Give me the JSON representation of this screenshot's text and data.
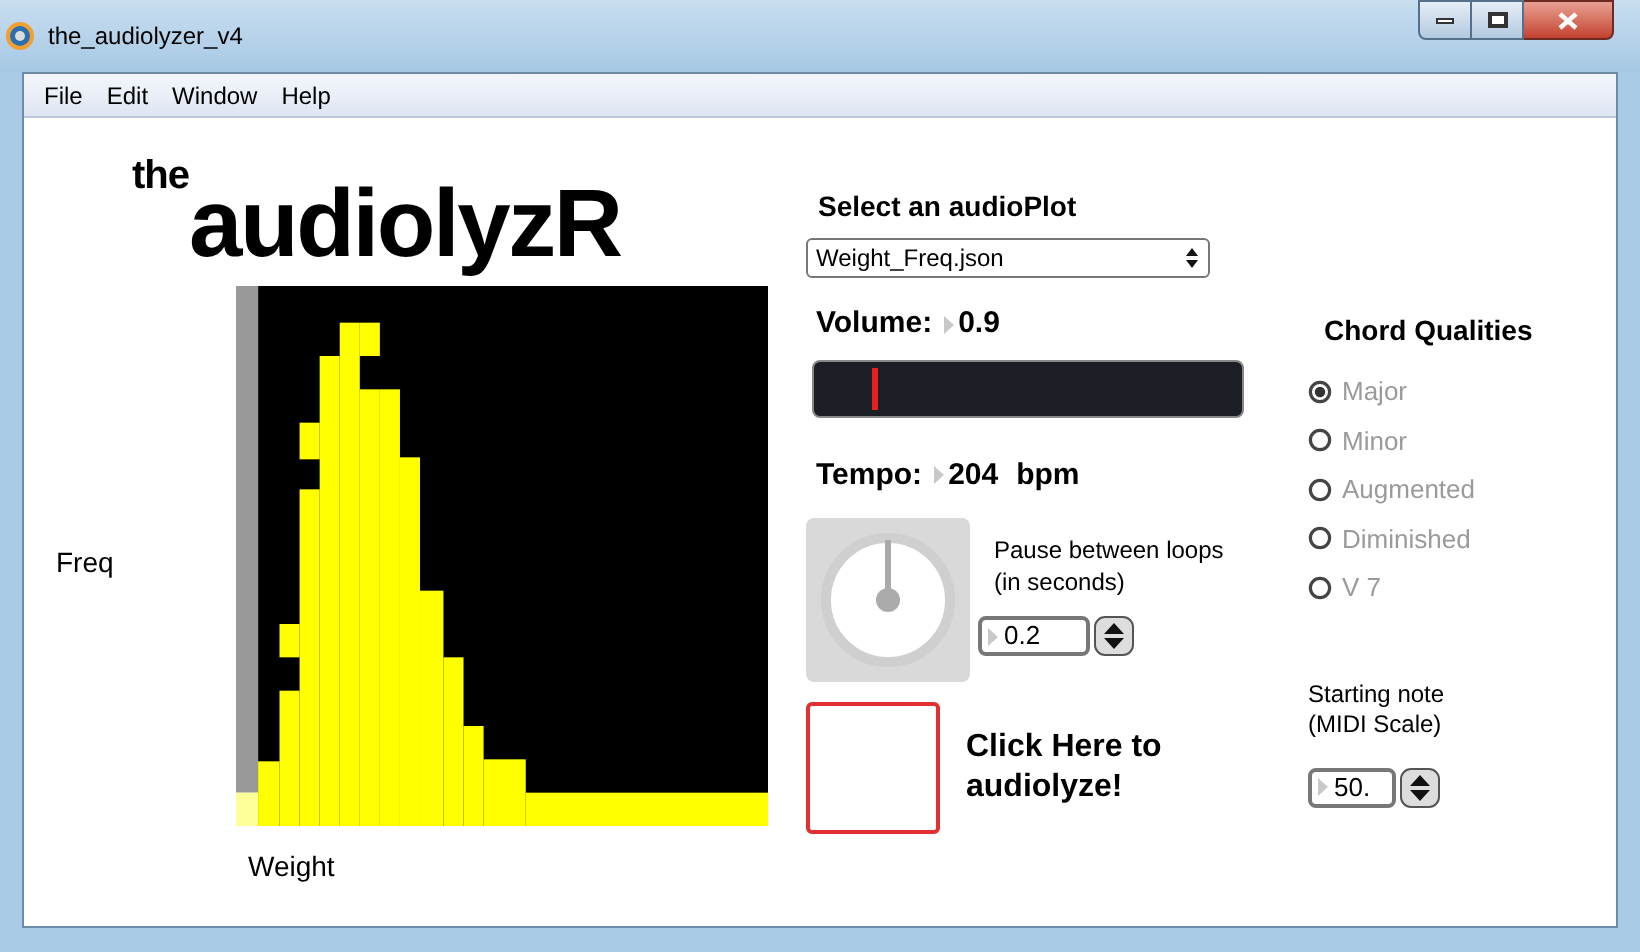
{
  "window": {
    "title": "the_audiolyzer_v4"
  },
  "menu": [
    "File",
    "Edit",
    "Window",
    "Help"
  ],
  "logo": {
    "prefix": "the",
    "name": "audiolyzR"
  },
  "plot": {
    "ylabel": "Freq",
    "xlabel": "Weight"
  },
  "audioplot": {
    "label": "Select an audioPlot",
    "value": "Weight_Freq.json"
  },
  "volume": {
    "label": "Volume:",
    "value": "0.9",
    "level": 0.14
  },
  "tempo": {
    "label": "Tempo:",
    "value": "204",
    "unit": "bpm"
  },
  "pause": {
    "label": "Pause between loops (in seconds)",
    "value": "0.2"
  },
  "audiolyze": {
    "label": "Click Here to audiolyze!"
  },
  "chords": {
    "title": "Chord Qualities",
    "options": [
      {
        "label": "Major",
        "selected": true,
        "disabled": true
      },
      {
        "label": "Minor",
        "selected": false,
        "disabled": true
      },
      {
        "label": "Augmented",
        "selected": false,
        "disabled": true
      },
      {
        "label": "Diminished",
        "selected": false,
        "disabled": true
      },
      {
        "label": "V 7",
        "selected": false,
        "disabled": true
      }
    ]
  },
  "start_note": {
    "label": "Starting note (MIDI Scale)",
    "value": "50."
  }
}
